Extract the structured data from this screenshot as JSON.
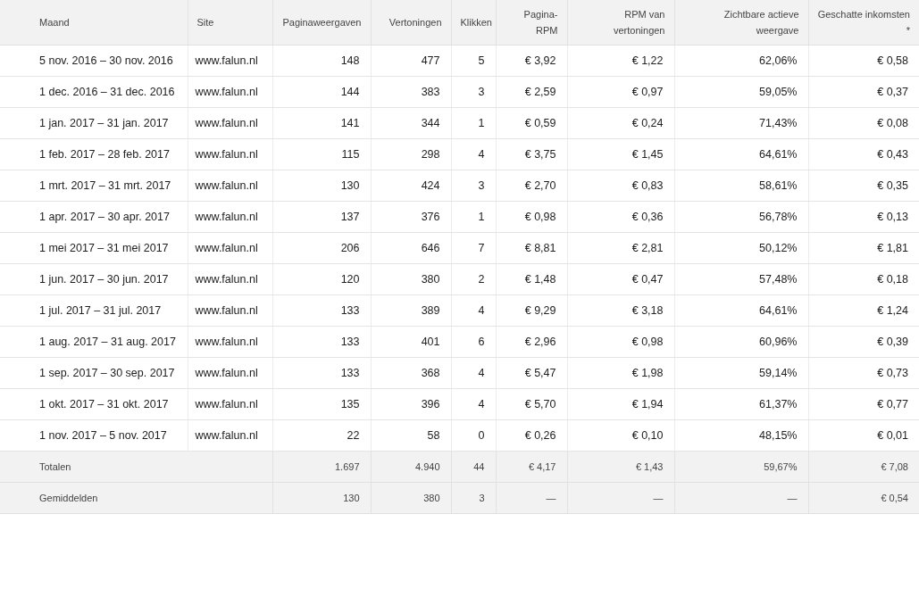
{
  "table": {
    "columns": [
      "Maand",
      "Site",
      "Paginaweergaven",
      "Vertoningen",
      "Klikken",
      "Pagina-RPM",
      "RPM van vertoningen",
      "Zichtbare actieve weergave",
      "Geschatte inkomsten *"
    ],
    "rows": [
      [
        "5 nov. 2016 – 30 nov. 2016",
        "www.falun.nl",
        "148",
        "477",
        "5",
        "€ 3,92",
        "€ 1,22",
        "62,06%",
        "€ 0,58"
      ],
      [
        "1 dec. 2016 – 31 dec. 2016",
        "www.falun.nl",
        "144",
        "383",
        "3",
        "€ 2,59",
        "€ 0,97",
        "59,05%",
        "€ 0,37"
      ],
      [
        "1 jan. 2017 – 31 jan. 2017",
        "www.falun.nl",
        "141",
        "344",
        "1",
        "€ 0,59",
        "€ 0,24",
        "71,43%",
        "€ 0,08"
      ],
      [
        "1 feb. 2017 – 28 feb. 2017",
        "www.falun.nl",
        "115",
        "298",
        "4",
        "€ 3,75",
        "€ 1,45",
        "64,61%",
        "€ 0,43"
      ],
      [
        "1 mrt. 2017 – 31 mrt. 2017",
        "www.falun.nl",
        "130",
        "424",
        "3",
        "€ 2,70",
        "€ 0,83",
        "58,61%",
        "€ 0,35"
      ],
      [
        "1 apr. 2017 – 30 apr. 2017",
        "www.falun.nl",
        "137",
        "376",
        "1",
        "€ 0,98",
        "€ 0,36",
        "56,78%",
        "€ 0,13"
      ],
      [
        "1 mei 2017 – 31 mei 2017",
        "www.falun.nl",
        "206",
        "646",
        "7",
        "€ 8,81",
        "€ 2,81",
        "50,12%",
        "€ 1,81"
      ],
      [
        "1 jun. 2017 – 30 jun. 2017",
        "www.falun.nl",
        "120",
        "380",
        "2",
        "€ 1,48",
        "€ 0,47",
        "57,48%",
        "€ 0,18"
      ],
      [
        "1 jul. 2017 – 31 jul. 2017",
        "www.falun.nl",
        "133",
        "389",
        "4",
        "€ 9,29",
        "€ 3,18",
        "64,61%",
        "€ 1,24"
      ],
      [
        "1 aug. 2017 – 31 aug. 2017",
        "www.falun.nl",
        "133",
        "401",
        "6",
        "€ 2,96",
        "€ 0,98",
        "60,96%",
        "€ 0,39"
      ],
      [
        "1 sep. 2017 – 30 sep. 2017",
        "www.falun.nl",
        "133",
        "368",
        "4",
        "€ 5,47",
        "€ 1,98",
        "59,14%",
        "€ 0,73"
      ],
      [
        "1 okt. 2017 – 31 okt. 2017",
        "www.falun.nl",
        "135",
        "396",
        "4",
        "€ 5,70",
        "€ 1,94",
        "61,37%",
        "€ 0,77"
      ],
      [
        "1 nov. 2017 – 5 nov. 2017",
        "www.falun.nl",
        "22",
        "58",
        "0",
        "€ 0,26",
        "€ 0,10",
        "48,15%",
        "€ 0,01"
      ]
    ],
    "summary_rows": [
      {
        "label": "Totalen",
        "values": [
          "1.697",
          "4.940",
          "44",
          "€ 4,17",
          "€ 1,43",
          "59,67%",
          "€ 7,08"
        ]
      },
      {
        "label": "Gemiddelden",
        "values": [
          "130",
          "380",
          "3",
          "—",
          "—",
          "—",
          "€ 0,54"
        ]
      }
    ]
  }
}
